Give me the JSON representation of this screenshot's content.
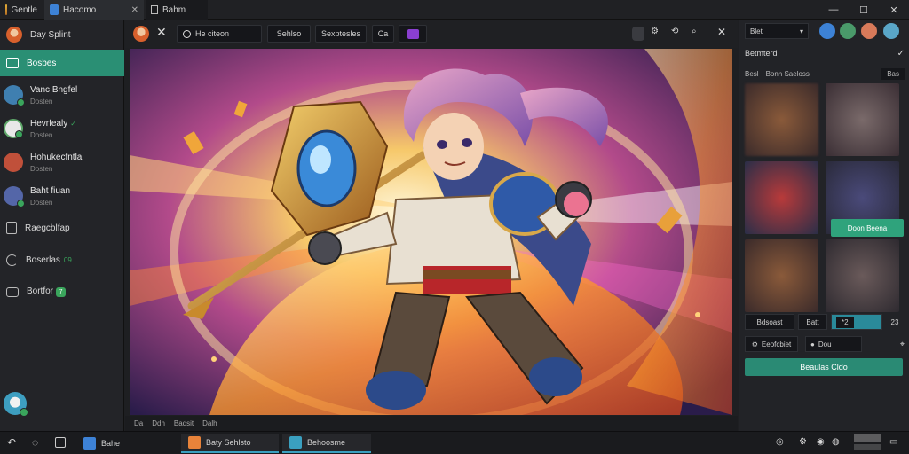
{
  "titlebar": {
    "tabs": [
      {
        "label": "Gentle"
      },
      {
        "label": "Hacomo"
      },
      {
        "label": "Bahm"
      }
    ],
    "controls": {
      "minimize": "—",
      "maximize": "☐",
      "close": "✕"
    }
  },
  "sidebar": {
    "header": {
      "label": "Day Splint"
    },
    "active_item": {
      "label": "Bosbes"
    },
    "contacts": [
      {
        "name": "Vanc Bngfel",
        "sub": "Dosten",
        "color": "#3f7fb0"
      },
      {
        "name": "Hevrfealy",
        "sub": "Dosten",
        "badge": "✓",
        "color": "#5fa86a"
      },
      {
        "name": "Hohukecfntla",
        "sub": "Dosten",
        "color": "#c0503a"
      },
      {
        "name": "Baht fiuan",
        "sub": "Dosten",
        "color": "#5466a8"
      }
    ],
    "items": [
      {
        "label": "Raegcblfap"
      },
      {
        "label": "Boserlas",
        "badge": "09"
      },
      {
        "label": "Bortfor",
        "badge": "7"
      }
    ]
  },
  "viewer": {
    "toolbar": {
      "search_placeholder": "He citeon",
      "btn1": "Sehlso",
      "btn2": "Sexptesles",
      "btn3": "Ca"
    },
    "status": [
      "Da",
      "Ddh",
      "Badsit",
      "Dalh"
    ]
  },
  "rpanel": {
    "dropdown": "Blet",
    "section_title": "Betmterd",
    "tabs": [
      "Besl",
      "Bonh Saeloss"
    ],
    "tab_right": "Bas",
    "thumb_action": "Doon Beena",
    "row1": [
      "Bdsoast",
      "Batt",
      "*2"
    ],
    "row1_end": "23",
    "row2": [
      "Eeofcbiet",
      "Dou"
    ],
    "primary_button": "Beaulas Cldo"
  },
  "taskbar": {
    "apps": [
      {
        "label": "Bahe"
      },
      {
        "label": "Baty Sehlsto"
      },
      {
        "label": "Behoosme"
      }
    ]
  },
  "colors": {
    "accent": "#2a8f74",
    "bg": "#1e1f22",
    "panel": "#232428"
  }
}
